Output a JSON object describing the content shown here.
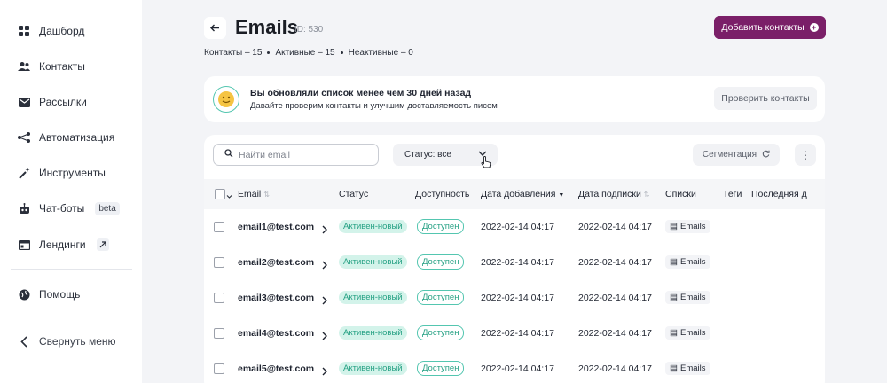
{
  "sidebar": {
    "items": [
      {
        "label": "Дашборд",
        "icon": "dashboard-icon"
      },
      {
        "label": "Контакты",
        "icon": "contacts-icon"
      },
      {
        "label": "Рассылки",
        "icon": "mail-icon"
      },
      {
        "label": "Автоматизация",
        "icon": "automation-icon"
      },
      {
        "label": "Инструменты",
        "icon": "tools-icon"
      },
      {
        "label": "Чат-боты",
        "icon": "bot-icon",
        "badge": "beta"
      },
      {
        "label": "Лендинги",
        "icon": "landing-icon"
      }
    ],
    "help": "Помощь",
    "collapse": "Свернуть меню"
  },
  "header": {
    "title": "Emails",
    "id_label": "ID: 530",
    "counts": [
      "Контакты – 15",
      "Активные – 15",
      "Неактивные – 0"
    ],
    "add_button": "Добавить контакты"
  },
  "notice": {
    "title": "Вы обновляли список менее чем 30 дней назад",
    "subtitle": "Давайте проверим контакты и улучшим доставляемость писем",
    "button": "Проверить контакты"
  },
  "toolbar": {
    "search_placeholder": "Найти email",
    "status_filter": "Статус: все",
    "segmentation": "Сегментация",
    "more": "⋮"
  },
  "table": {
    "headers": [
      "Email",
      "Статус",
      "Доступность",
      "Дата добавления",
      "Дата подписки",
      "Списки",
      "Теги",
      "Последняя д"
    ],
    "rows": [
      {
        "email": "email1@test.com",
        "status": "Активен-новый",
        "availability": "Доступен",
        "added": "2022-02-14 04:17",
        "subscribed": "2022-02-14 04:17",
        "list": "Emails"
      },
      {
        "email": "email2@test.com",
        "status": "Активен-новый",
        "availability": "Доступен",
        "added": "2022-02-14 04:17",
        "subscribed": "2022-02-14 04:17",
        "list": "Emails"
      },
      {
        "email": "email3@test.com",
        "status": "Активен-новый",
        "availability": "Доступен",
        "added": "2022-02-14 04:17",
        "subscribed": "2022-02-14 04:17",
        "list": "Emails"
      },
      {
        "email": "email4@test.com",
        "status": "Активен-новый",
        "availability": "Доступен",
        "added": "2022-02-14 04:17",
        "subscribed": "2022-02-14 04:17",
        "list": "Emails"
      },
      {
        "email": "email5@test.com",
        "status": "Активен-новый",
        "availability": "Доступен",
        "added": "2022-02-14 04:17",
        "subscribed": "2022-02-14 04:17",
        "list": "Emails"
      }
    ]
  },
  "colors": {
    "brand": "#7a1f68",
    "status_green": "#26a184",
    "status_bg": "#d3f3ea"
  }
}
